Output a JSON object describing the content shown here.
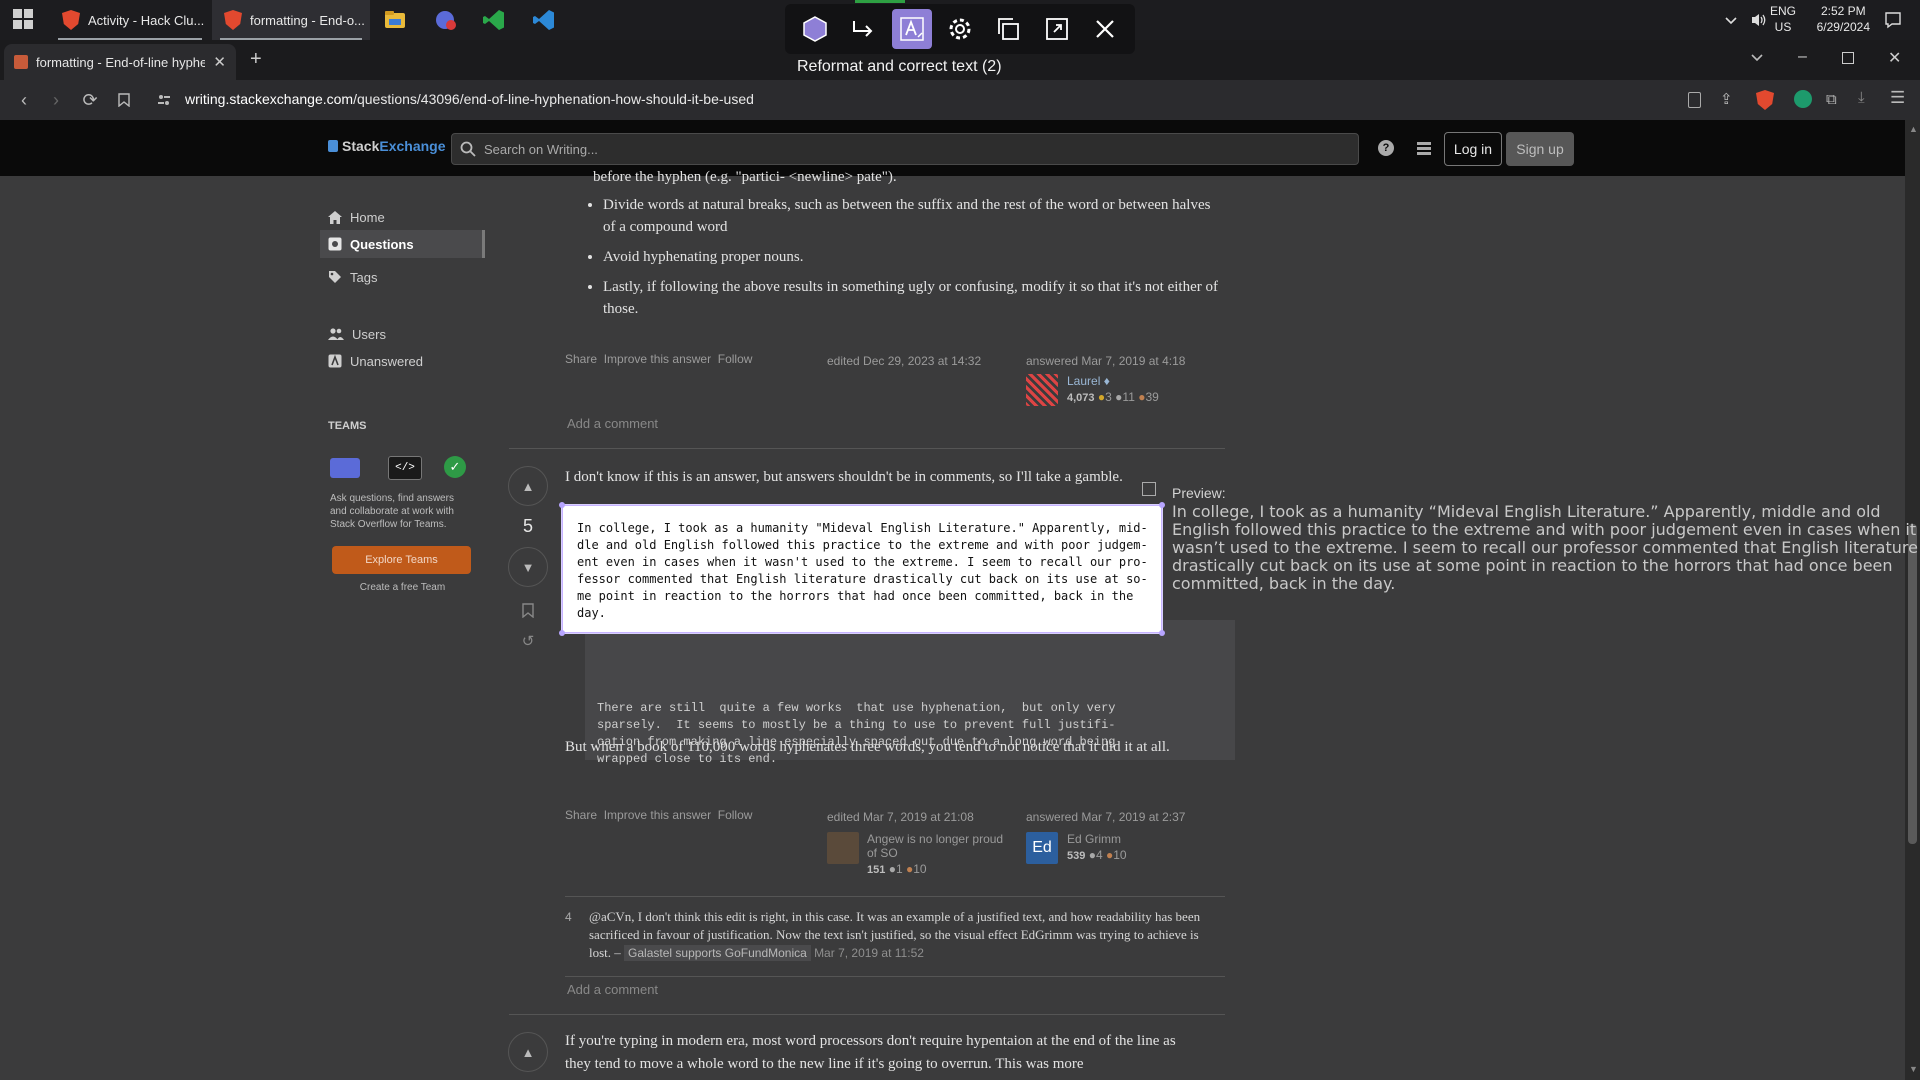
{
  "taskbar": {
    "tasks": [
      {
        "label": "Activity - Hack Clu..."
      },
      {
        "label": "formatting - End-o..."
      }
    ],
    "lang_line1": "ENG",
    "lang_line2": "US",
    "time": "2:52 PM",
    "date": "6/29/2024"
  },
  "ocr_tool": {
    "status": "Reformat and correct text (2)",
    "extracted_text": "In college, I took as a humanity \"Mideval English Literature.\" Apparently, mid-\ndle and old English followed this practice to the extreme and with poor judgem-\nent even in cases when it wasn't used to the extreme. I seem to recall our pro-\nfessor commented that English literature drastically cut back on its use at so-\nme point in reaction to the horrors that had once been committed, back in the\nday.",
    "preview_label": "Preview:",
    "preview_text": "In college, I took as a humanity “Mideval English Literature.” Apparently, middle and old English followed this practice to the extreme and with poor judgement even in cases when it wasn’t used to the extreme. I seem to recall our professor commented that English literature drastically cut back on its use at some point in reaction to the horrors that had once been committed, back in the day."
  },
  "browser": {
    "tab_title": "formatting - End-of-line hyphen",
    "url_host": "writing.stackexchange.com",
    "url_path": "/questions/43096/end-of-line-hyphenation-how-should-it-be-used"
  },
  "site": {
    "logo_a": "Stack",
    "logo_b": "Exchange",
    "search_placeholder": "Search on Writing...",
    "login": "Log in",
    "signup": "Sign up"
  },
  "left_nav": {
    "home": "Home",
    "questions": "Questions",
    "tags": "Tags",
    "users": "Users",
    "unanswered": "Unanswered",
    "teams_heading": "TEAMS",
    "teams_text": "Ask questions, find answers and collaborate at work with Stack Overflow for Teams.",
    "explore_button": "Explore Teams",
    "create_team": "Create a free Team"
  },
  "answer1": {
    "cut_line": "before the hyphen (e.g. \"partici- <newline> pate\").",
    "bullets": [
      "Divide words at natural breaks, such as between the suffix and the rest of the word or between halves of a compound word",
      "Avoid hyphenating proper nouns.",
      "Lastly, if following the above results in something ugly or confusing, modify it so that it's not either of those."
    ],
    "share": "Share",
    "improve": "Improve this answer",
    "follow": "Follow",
    "edited": "edited Dec 29, 2023 at 14:32",
    "answered": "answered Mar 7, 2019 at 4:18",
    "user": "Laurel",
    "rep": "4,073",
    "gold": "3",
    "silver": "11",
    "bronze": "39",
    "add_comment": "Add a comment"
  },
  "answer2": {
    "votes": "5",
    "intro": "I don't know if this is an answer, but answers shouldn't be in comments, so I'll take a gamble.",
    "code_text": "There are still  quite a few works  that use hyphenation,  but only very\nsparsely.  It seems to mostly be a thing to use to prevent full justifi-\ncation from making a line especially spaced out due to a long word being\nwrapped close to its end.",
    "closing": "But when a book of 110,000 words hyphenates three words, you tend to not notice that it did it at all.",
    "share": "Share",
    "improve": "Improve this answer",
    "follow": "Follow",
    "edited": "edited Mar 7, 2019 at 21:08",
    "editor_name": "Angew is no longer proud of SO",
    "editor_rep": "151",
    "editor_silver": "1",
    "editor_bronze": "10",
    "answered": "answered Mar 7, 2019 at 2:37",
    "author_avatar": "Ed",
    "author_name": "Ed Grimm",
    "author_rep": "539",
    "author_silver": "4",
    "author_bronze": "10",
    "comment_votes": "4",
    "comment_text": "@aCVn, I don't think this edit is right, in this case. It was an example of a justified text, and how readability has been sacrificed in favour of justification. Now the text isn't justified, so the visual effect EdGrimm was trying to achieve is lost. –",
    "comment_user": "Galastel supports GoFundMonica",
    "comment_date": "Mar 7, 2019 at 11:52",
    "add_comment": "Add a comment"
  },
  "answer3": {
    "text": "If you're typing in modern era, most word processors don't require hypentaion at the end of the line as they tend to move a whole word to the new line if it's going to overrun. This was more"
  },
  "colors": {
    "accent_purple": "#8e7fd6",
    "teams_orange": "#c05a1a",
    "link_blue": "#4a8fd8"
  }
}
